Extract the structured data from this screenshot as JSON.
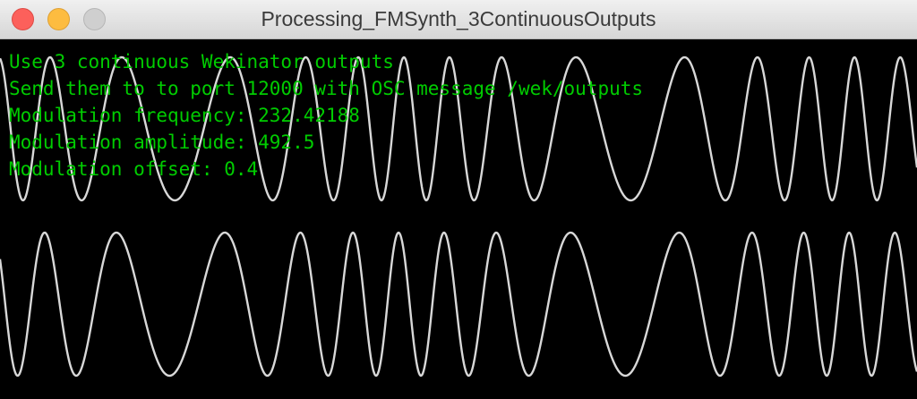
{
  "window": {
    "title": "Processing_FMSynth_3ContinuousOutputs"
  },
  "readout": {
    "line1": "Use 3 continuous Wekinator outputs",
    "line2": "Send them to to port 12000 with OSC message /wek/outputs",
    "line3": "Modulation frequency: 232.42188",
    "line4": "Modulation amplitude: 492.5",
    "line5": "Modulation offset: 0.4"
  },
  "colors": {
    "text": "#00cc00",
    "waveform": "#d8d8d8",
    "background": "#000000"
  }
}
